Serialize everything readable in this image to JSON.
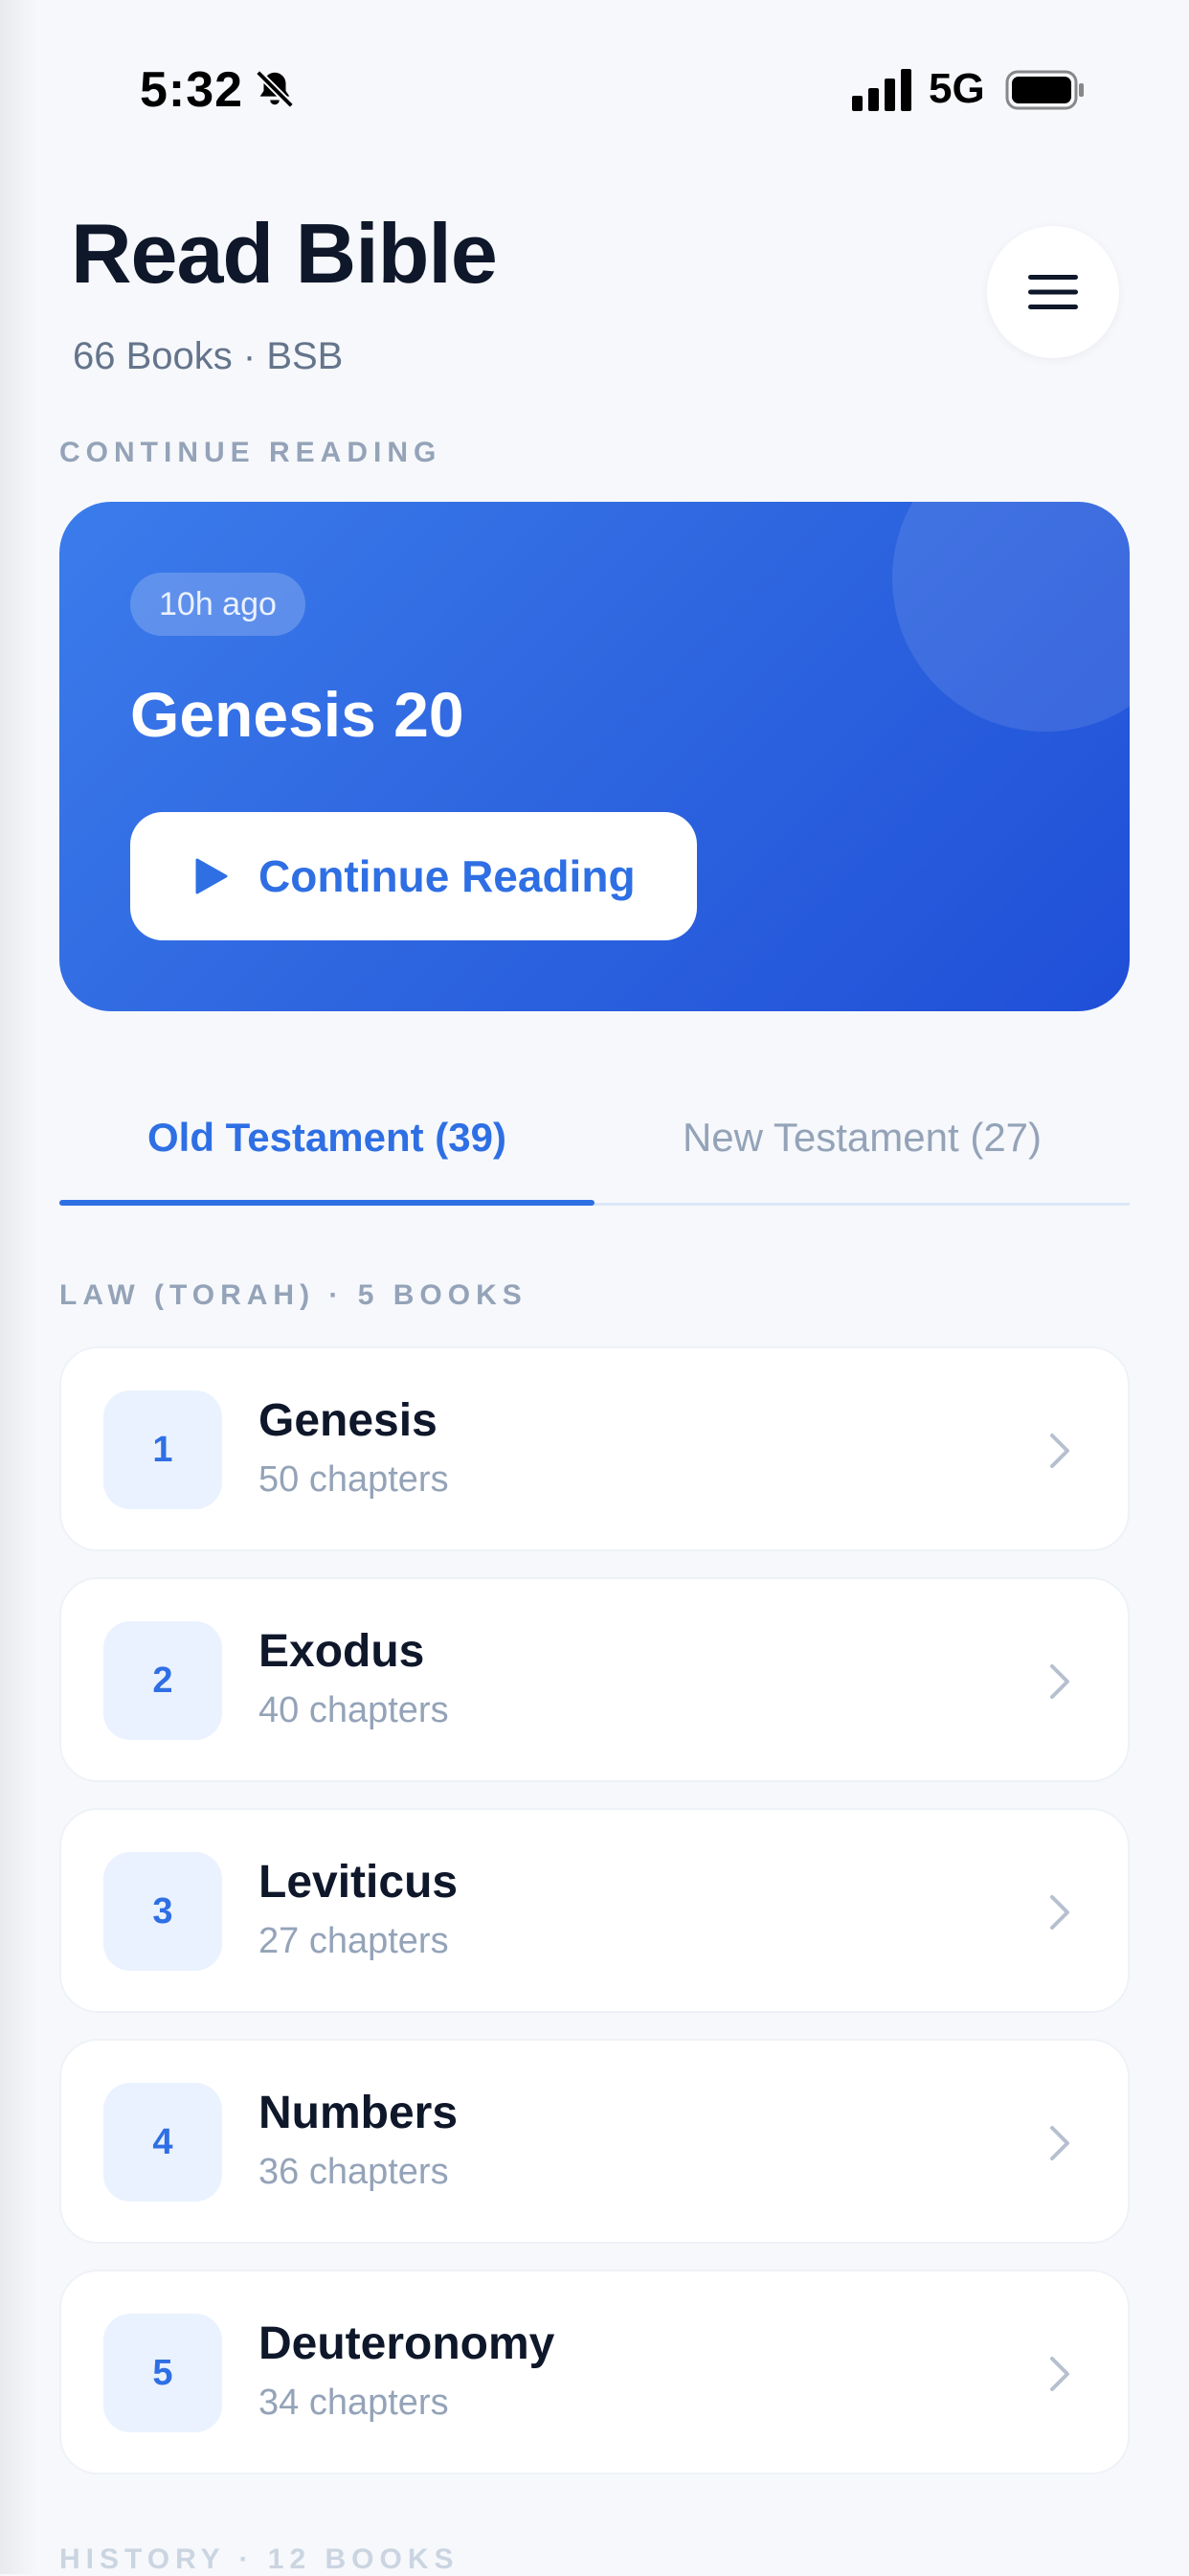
{
  "status_bar": {
    "time": "5:32",
    "network": "5G"
  },
  "header": {
    "title": "Read Bible",
    "subtitle": "66 Books · BSB",
    "menu_icon": "hamburger-menu-icon"
  },
  "continue_section": {
    "label": "CONTINUE READING",
    "badge": "10h ago",
    "title": "Genesis 20",
    "button_label": "Continue Reading"
  },
  "tabs": [
    {
      "label": "Old Testament (39)",
      "active": true
    },
    {
      "label": "New Testament (27)",
      "active": false
    }
  ],
  "sections": [
    {
      "label": "LAW (TORAH) · 5 BOOKS",
      "books": [
        {
          "number": "1",
          "name": "Genesis",
          "chapters": "50 chapters"
        },
        {
          "number": "2",
          "name": "Exodus",
          "chapters": "40 chapters"
        },
        {
          "number": "3",
          "name": "Leviticus",
          "chapters": "27 chapters"
        },
        {
          "number": "4",
          "name": "Numbers",
          "chapters": "36 chapters"
        },
        {
          "number": "5",
          "name": "Deuteronomy",
          "chapters": "34 chapters"
        }
      ]
    },
    {
      "label": "HISTORY · 12 BOOKS"
    }
  ],
  "colors": {
    "accent": "#2f6fe4",
    "card_gradient_start": "#3b7cec",
    "card_gradient_end": "#1f4fd8",
    "muted_text": "#94a3b8",
    "title_text": "#0f172a"
  }
}
